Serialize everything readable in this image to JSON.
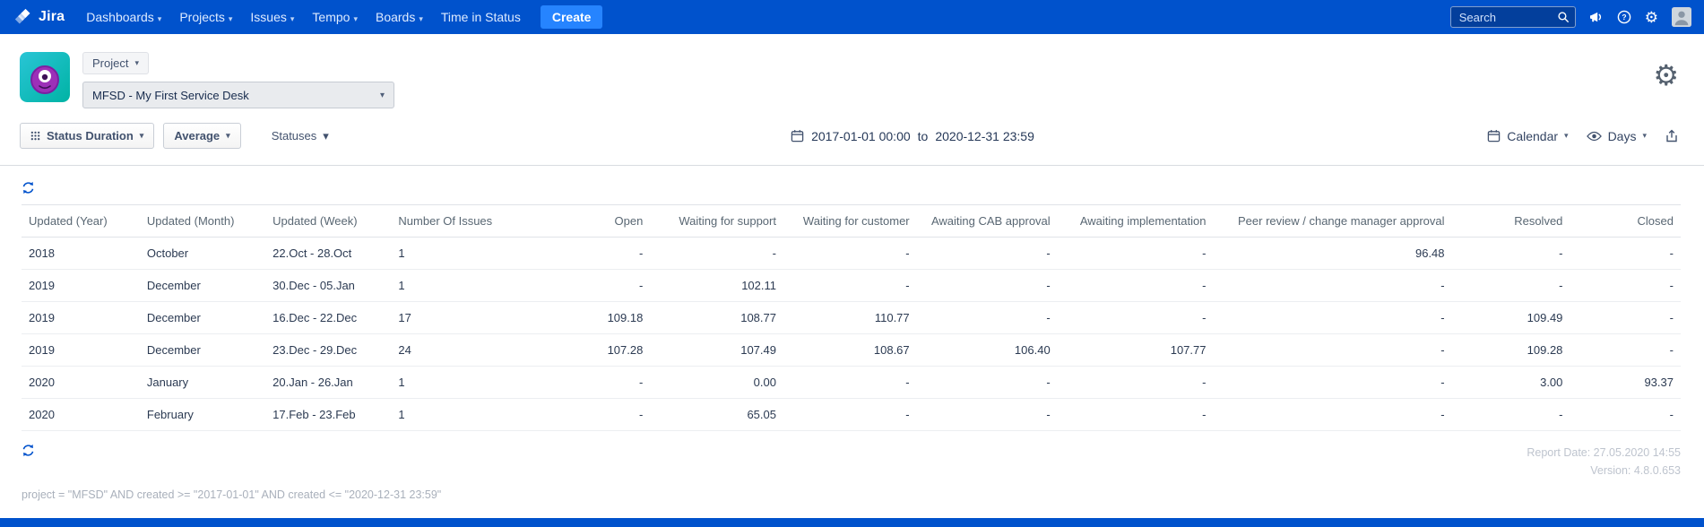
{
  "navbar": {
    "brand": "Jira",
    "items": [
      {
        "label": "Dashboards",
        "caret": true
      },
      {
        "label": "Projects",
        "caret": true
      },
      {
        "label": "Issues",
        "caret": true
      },
      {
        "label": "Tempo",
        "caret": true
      },
      {
        "label": "Boards",
        "caret": true
      },
      {
        "label": "Time in Status",
        "caret": false
      }
    ],
    "create_label": "Create",
    "search_placeholder": "Search"
  },
  "project_header": {
    "scope_button_label": "Project",
    "project_select_value": "MFSD - My First Service Desk"
  },
  "toolbar": {
    "metric_button_label": "Status Duration",
    "aggregation_button_label": "Average",
    "statuses_button_label": "Statuses",
    "date_from": "2017-01-01 00:00",
    "date_separator": "to",
    "date_to": "2020-12-31 23:59",
    "calendar_button_label": "Calendar",
    "units_button_label": "Days"
  },
  "table": {
    "columns": [
      "Updated (Year)",
      "Updated (Month)",
      "Updated (Week)",
      "Number Of Issues",
      "Open",
      "Waiting for support",
      "Waiting for customer",
      "Awaiting CAB approval",
      "Awaiting implementation",
      "Peer review / change manager approval",
      "Resolved",
      "Closed"
    ],
    "rows": [
      [
        "2018",
        "October",
        "22.Oct - 28.Oct",
        "1",
        "-",
        "-",
        "-",
        "-",
        "-",
        "96.48",
        "-",
        "-"
      ],
      [
        "2019",
        "December",
        "30.Dec - 05.Jan",
        "1",
        "-",
        "102.11",
        "-",
        "-",
        "-",
        "-",
        "-",
        "-"
      ],
      [
        "2019",
        "December",
        "16.Dec - 22.Dec",
        "17",
        "109.18",
        "108.77",
        "110.77",
        "-",
        "-",
        "-",
        "109.49",
        "-"
      ],
      [
        "2019",
        "December",
        "23.Dec - 29.Dec",
        "24",
        "107.28",
        "107.49",
        "108.67",
        "106.40",
        "107.77",
        "-",
        "109.28",
        "-"
      ],
      [
        "2020",
        "January",
        "20.Jan - 26.Jan",
        "1",
        "-",
        "0.00",
        "-",
        "-",
        "-",
        "-",
        "3.00",
        "93.37"
      ],
      [
        "2020",
        "February",
        "17.Feb - 23.Feb",
        "1",
        "-",
        "65.05",
        "-",
        "-",
        "-",
        "-",
        "-",
        "-"
      ]
    ]
  },
  "footer": {
    "report_date": "Report Date: 27.05.2020 14:55",
    "version": "Version: 4.8.0.653",
    "query": "project = \"MFSD\" AND created >= \"2017-01-01\" AND created <= \"2020-12-31 23:59\""
  },
  "colors": {
    "navbar_blue": "#0052CC",
    "create_button_blue": "#2684FF",
    "refresh_icon_blue": "#0052CC"
  }
}
